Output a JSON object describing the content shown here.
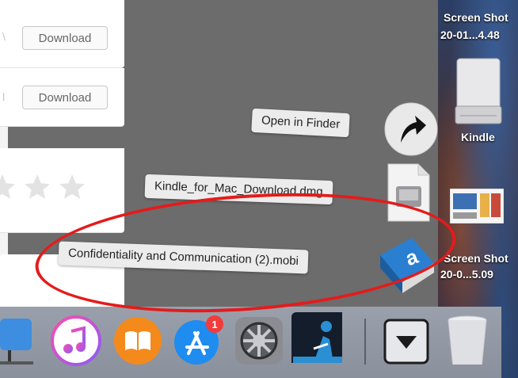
{
  "desktop": {
    "screenshot1": {
      "line1": "Screen Shot",
      "line2": "20-01...4.48"
    },
    "drive_label": "Kindle",
    "screenshot2": {
      "line1": "Screen Shot",
      "line2": "20-0...5.09"
    }
  },
  "browser": {
    "download_button_1": "Download",
    "download_button_2": "Download",
    "rating_stars": 3
  },
  "stack": {
    "open_in_finder": "Open in Finder",
    "item1": "Kindle_for_Mac_Download.dmg",
    "item2": "Confidentiality and Communication (2).mobi"
  },
  "dock": {
    "app_store_badge": "1",
    "icons": [
      "keynote-icon",
      "itunes-icon",
      "ibooks-icon",
      "app-store-icon",
      "system-preferences-icon",
      "kindle-icon",
      "downloads-stack-icon",
      "trash-icon"
    ]
  },
  "annotation": {
    "color": "#e41b1b"
  }
}
